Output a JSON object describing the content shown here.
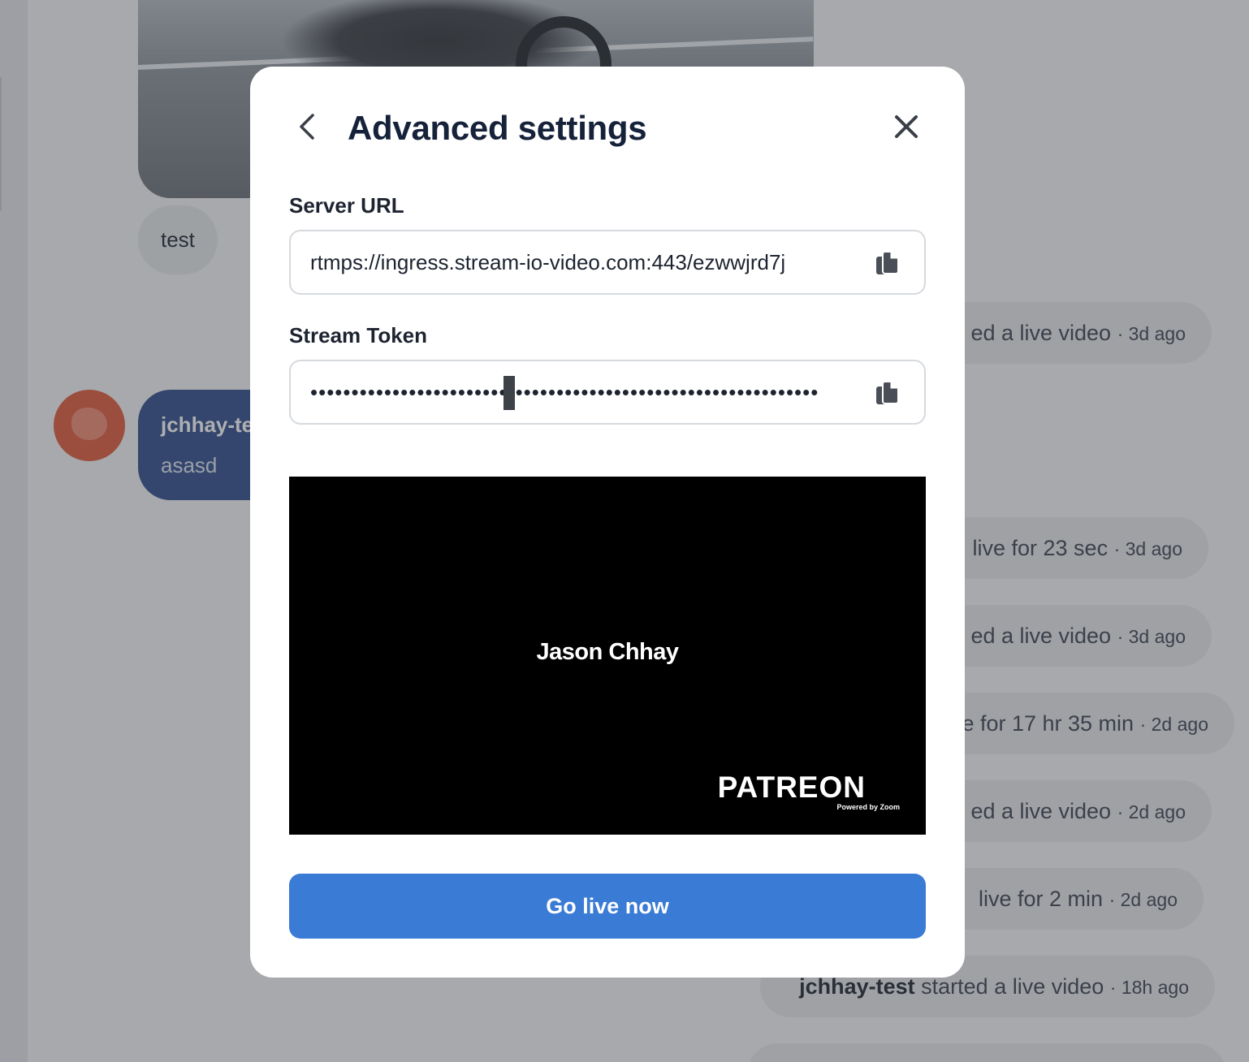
{
  "background": {
    "message_bubble": "test",
    "pinned_message": {
      "author": "jchhay-te",
      "text": "asasd"
    },
    "events": [
      {
        "text": "ed a live video",
        "time": "· 3d ago"
      },
      {
        "text": "live for 23 sec",
        "time": "· 3d ago"
      },
      {
        "text": "ed a live video",
        "time": "· 3d ago"
      },
      {
        "text": "e for 17 hr 35 min",
        "time": "· 2d ago"
      },
      {
        "text": "ed a live video",
        "time": "· 2d ago"
      },
      {
        "text": "live for 2 min",
        "time": "· 2d ago"
      },
      {
        "actor": "jchhay-test",
        "text": " started a live video",
        "time": "· 18h ago"
      }
    ]
  },
  "modal": {
    "title": "Advanced settings",
    "back_icon": "chevron-left-icon",
    "close_icon": "close-icon",
    "server_url": {
      "label": "Server URL",
      "value": "rtmps://ingress.stream-io-video.com:443/ezwwjrd7j",
      "copy_icon": "copy-icon"
    },
    "stream_token": {
      "label": "Stream Token",
      "value": "••••••••••••••••••••••••••••••••••••••••••••••••••••••••••••••",
      "copy_icon": "copy-icon"
    },
    "preview": {
      "name": "Jason Chhay",
      "brand": "PATREON",
      "powered_by": "Powered by Zoom"
    },
    "primary_button": "Go live now",
    "colors": {
      "primary": "#3a7bd5",
      "title": "#16223a",
      "overlay": "rgba(60,62,66,0.42)"
    }
  }
}
